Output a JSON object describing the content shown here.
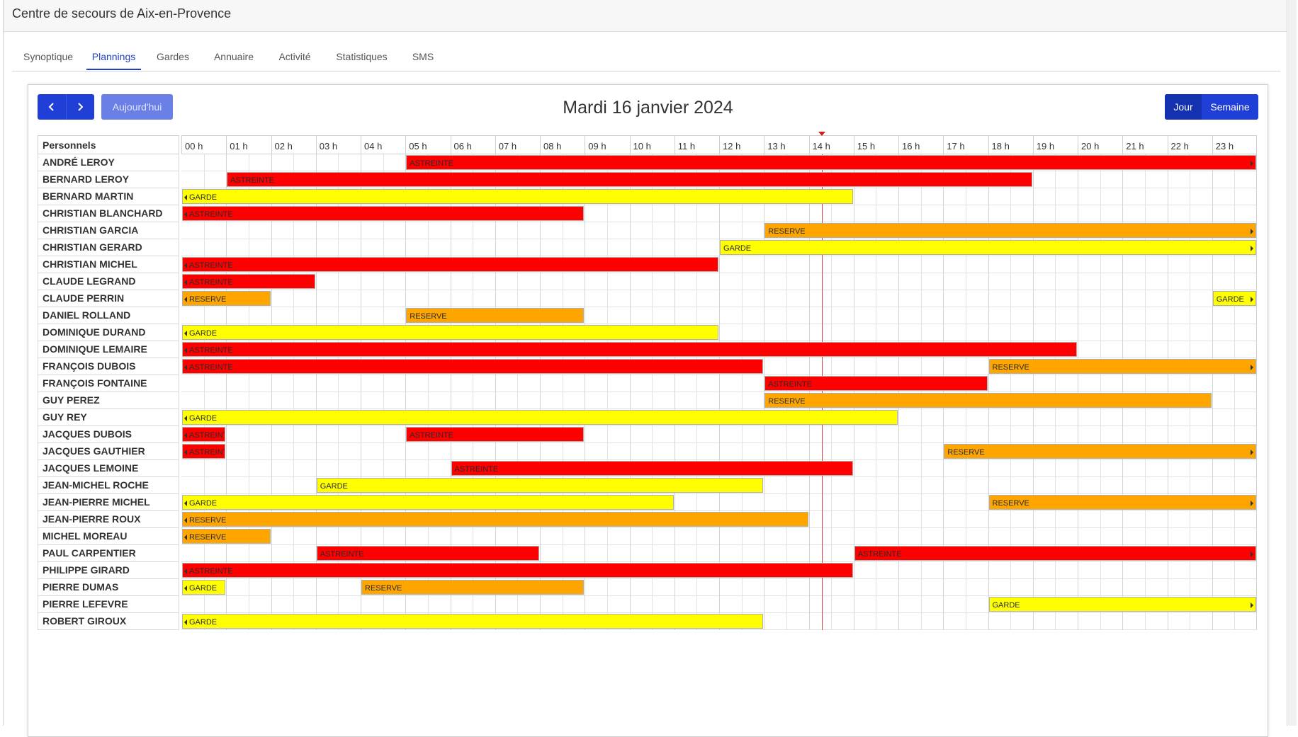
{
  "app": {
    "title": "Centre de secours de Aix-en-Provence"
  },
  "tabs": [
    {
      "label": "Synoptique",
      "active": false
    },
    {
      "label": "Plannings",
      "active": true
    },
    {
      "label": "Gardes",
      "active": false
    },
    {
      "label": "Annuaire",
      "active": false
    },
    {
      "label": "Activité",
      "active": false
    },
    {
      "label": "Statistiques",
      "active": false
    },
    {
      "label": "SMS",
      "active": false
    }
  ],
  "toolbar": {
    "prev_icon": "chevron-left-icon",
    "next_icon": "chevron-right-icon",
    "today_label": "Aujourd'hui",
    "date_title": "Mardi 16 janvier 2024",
    "view_day_label": "Jour",
    "view_week_label": "Semaine"
  },
  "grid": {
    "resource_header": "Personnels",
    "hours": [
      "00 h",
      "01 h",
      "02 h",
      "03 h",
      "04 h",
      "05 h",
      "06 h",
      "07 h",
      "08 h",
      "09 h",
      "10 h",
      "11 h",
      "12 h",
      "13 h",
      "14 h",
      "15 h",
      "16 h",
      "17 h",
      "18 h",
      "19 h",
      "20 h",
      "21 h",
      "22 h",
      "23 h"
    ],
    "now_hour": 14.3
  },
  "colors": {
    "ASTREINTE": "#ff0000",
    "RESERVE": "#ffa500",
    "GARDE": "#ffff00"
  },
  "rows": [
    {
      "name": "ANDRÉ LEROY",
      "events": [
        {
          "type": "ASTREINTE",
          "start": 5,
          "end": 24,
          "contRight": true
        }
      ]
    },
    {
      "name": "BERNARD LEROY",
      "events": [
        {
          "type": "ASTREINTE",
          "start": 1,
          "end": 19
        }
      ]
    },
    {
      "name": "BERNARD MARTIN",
      "events": [
        {
          "type": "GARDE",
          "start": 0,
          "end": 15,
          "contLeft": true
        }
      ]
    },
    {
      "name": "CHRISTIAN BLANCHARD",
      "events": [
        {
          "type": "ASTREINTE",
          "start": 0,
          "end": 9,
          "contLeft": true
        }
      ]
    },
    {
      "name": "CHRISTIAN GARCIA",
      "events": [
        {
          "type": "RESERVE",
          "start": 13,
          "end": 24,
          "contRight": true
        }
      ]
    },
    {
      "name": "CHRISTIAN GERARD",
      "events": [
        {
          "type": "GARDE",
          "start": 12,
          "end": 24,
          "contRight": true
        }
      ]
    },
    {
      "name": "CHRISTIAN MICHEL",
      "events": [
        {
          "type": "ASTREINTE",
          "start": 0,
          "end": 12,
          "contLeft": true
        }
      ]
    },
    {
      "name": "CLAUDE LEGRAND",
      "events": [
        {
          "type": "ASTREINTE",
          "start": 0,
          "end": 3,
          "contLeft": true
        }
      ]
    },
    {
      "name": "CLAUDE PERRIN",
      "events": [
        {
          "type": "RESERVE",
          "start": 0,
          "end": 2,
          "contLeft": true
        },
        {
          "type": "GARDE",
          "start": 23,
          "end": 24,
          "contRight": true
        }
      ]
    },
    {
      "name": "DANIEL ROLLAND",
      "events": [
        {
          "type": "RESERVE",
          "start": 5,
          "end": 9
        }
      ]
    },
    {
      "name": "DOMINIQUE DURAND",
      "events": [
        {
          "type": "GARDE",
          "start": 0,
          "end": 12,
          "contLeft": true
        }
      ]
    },
    {
      "name": "DOMINIQUE LEMAIRE",
      "events": [
        {
          "type": "ASTREINTE",
          "start": 0,
          "end": 20,
          "contLeft": true
        }
      ]
    },
    {
      "name": "FRANÇOIS DUBOIS",
      "events": [
        {
          "type": "ASTREINTE",
          "start": 0,
          "end": 13,
          "contLeft": true
        },
        {
          "type": "RESERVE",
          "start": 18,
          "end": 24,
          "contRight": true
        }
      ]
    },
    {
      "name": "FRANÇOIS FONTAINE",
      "events": [
        {
          "type": "ASTREINTE",
          "start": 13,
          "end": 18
        }
      ]
    },
    {
      "name": "GUY PEREZ",
      "events": [
        {
          "type": "RESERVE",
          "start": 13,
          "end": 23
        }
      ]
    },
    {
      "name": "GUY REY",
      "events": [
        {
          "type": "GARDE",
          "start": 0,
          "end": 16,
          "contLeft": true
        }
      ]
    },
    {
      "name": "JACQUES DUBOIS",
      "events": [
        {
          "type": "ASTREINTE",
          "start": 0,
          "end": 1,
          "contLeft": true
        },
        {
          "type": "ASTREINTE",
          "start": 5,
          "end": 9
        }
      ]
    },
    {
      "name": "JACQUES GAUTHIER",
      "events": [
        {
          "type": "ASTREINTE",
          "start": 0,
          "end": 1,
          "contLeft": true
        },
        {
          "type": "RESERVE",
          "start": 17,
          "end": 24,
          "contRight": true
        }
      ]
    },
    {
      "name": "JACQUES LEMOINE",
      "events": [
        {
          "type": "ASTREINTE",
          "start": 6,
          "end": 15
        }
      ]
    },
    {
      "name": "JEAN-MICHEL ROCHE",
      "events": [
        {
          "type": "GARDE",
          "start": 3,
          "end": 13
        }
      ]
    },
    {
      "name": "JEAN-PIERRE MICHEL",
      "events": [
        {
          "type": "GARDE",
          "start": 0,
          "end": 11,
          "contLeft": true
        },
        {
          "type": "RESERVE",
          "start": 18,
          "end": 24,
          "contRight": true
        }
      ]
    },
    {
      "name": "JEAN-PIERRE ROUX",
      "events": [
        {
          "type": "RESERVE",
          "start": 0,
          "end": 14,
          "contLeft": true
        }
      ]
    },
    {
      "name": "MICHEL MOREAU",
      "events": [
        {
          "type": "RESERVE",
          "start": 0,
          "end": 2,
          "contLeft": true
        }
      ]
    },
    {
      "name": "PAUL CARPENTIER",
      "events": [
        {
          "type": "ASTREINTE",
          "start": 3,
          "end": 8
        },
        {
          "type": "ASTREINTE",
          "start": 15,
          "end": 24,
          "contRight": true
        }
      ]
    },
    {
      "name": "PHILIPPE GIRARD",
      "events": [
        {
          "type": "ASTREINTE",
          "start": 0,
          "end": 15,
          "contLeft": true
        }
      ]
    },
    {
      "name": "PIERRE DUMAS",
      "events": [
        {
          "type": "GARDE",
          "start": 0,
          "end": 1,
          "contLeft": true
        },
        {
          "type": "RESERVE",
          "start": 4,
          "end": 9
        }
      ]
    },
    {
      "name": "PIERRE LEFEVRE",
      "events": [
        {
          "type": "GARDE",
          "start": 18,
          "end": 24,
          "contRight": true
        }
      ]
    },
    {
      "name": "ROBERT GIROUX",
      "events": [
        {
          "type": "GARDE",
          "start": 0,
          "end": 13,
          "contLeft": true
        }
      ]
    }
  ]
}
